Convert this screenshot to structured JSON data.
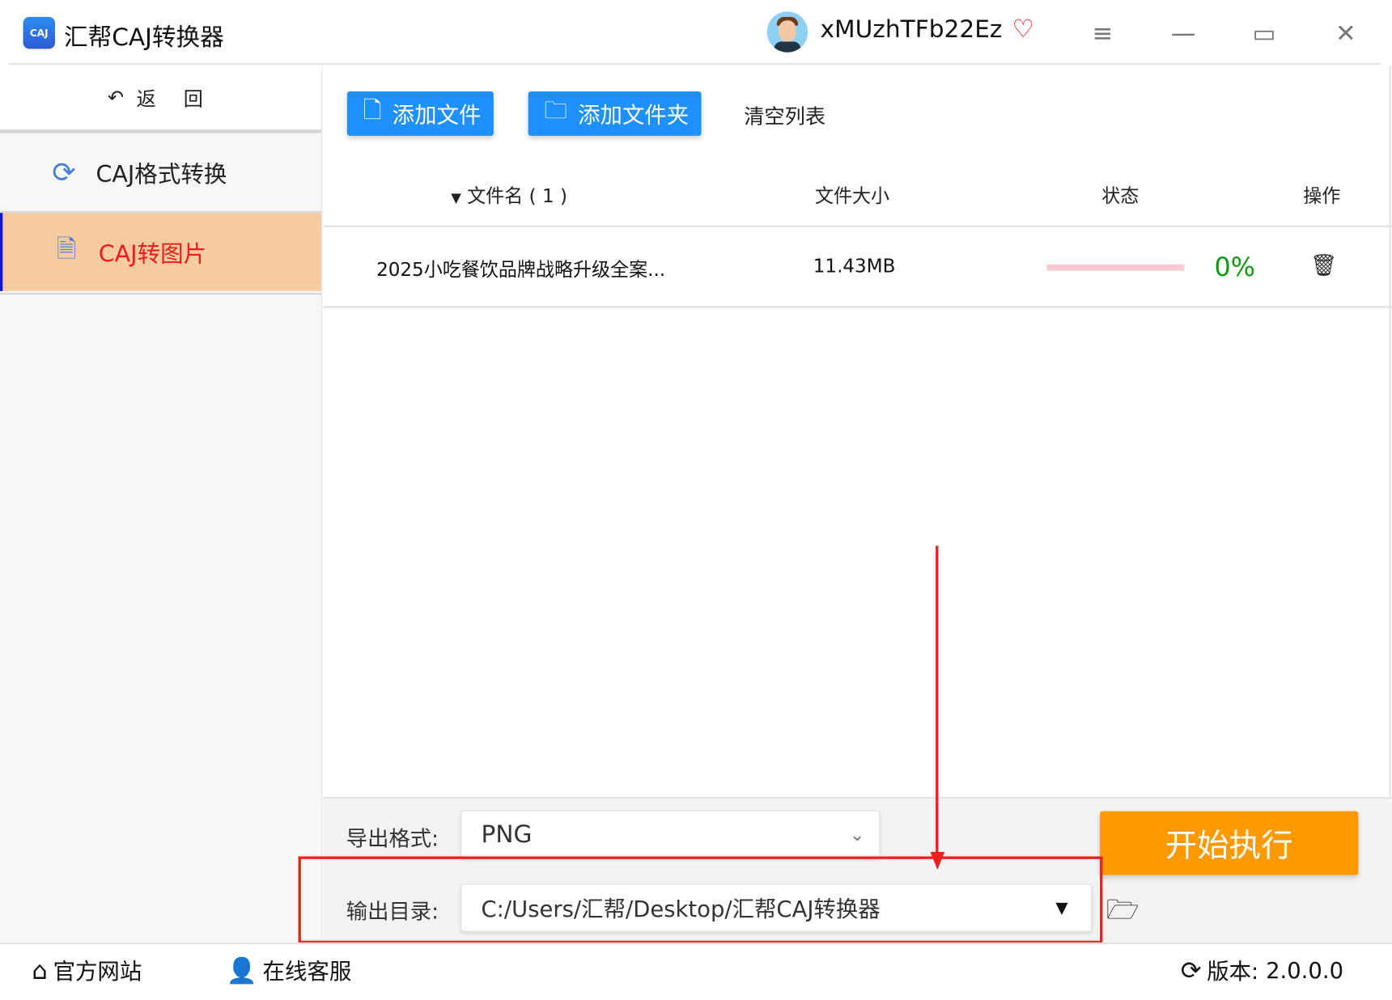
{
  "app": {
    "logo_text": "CAJ",
    "title": "汇帮CAJ转换器",
    "username": "xMUzhTFb22Ez"
  },
  "window": {
    "menu": "≡",
    "minimize": "—",
    "maximize": "▭",
    "close": "✕"
  },
  "sidebar": {
    "back_label": "返 回",
    "items": [
      {
        "label": "CAJ格式转换",
        "icon": "refresh-icon"
      },
      {
        "label": "CAJ转图片",
        "icon": "document-icon",
        "active": true
      }
    ]
  },
  "toolbar": {
    "add_file": "添加文件",
    "add_folder": "添加文件夹",
    "clear_list": "清空列表"
  },
  "table": {
    "headers": {
      "name": "文件名 ( 1 )",
      "size": "文件大小",
      "status": "状态",
      "action": "操作"
    },
    "rows": [
      {
        "name": "2025小吃餐饮品牌战略升级全案...",
        "size": "11.43MB",
        "progress": 0,
        "progress_text": "0%"
      }
    ]
  },
  "settings": {
    "format_label": "导出格式:",
    "format_value": "PNG",
    "output_label": "输出目录:",
    "output_value": "C:/Users/汇帮/Desktop/汇帮CAJ转换器",
    "start_button": "开始执行"
  },
  "footer": {
    "website": "官方网站",
    "support": "在线客服",
    "version_label": "版本:",
    "version": "2.0.0.0"
  },
  "colors": {
    "primary": "#1e90ff",
    "start": "#ff9900",
    "active_bg": "#f6cba0",
    "active_text": "#f21b1b",
    "progress_text": "#119a11",
    "annotation": "#f01e1e"
  }
}
